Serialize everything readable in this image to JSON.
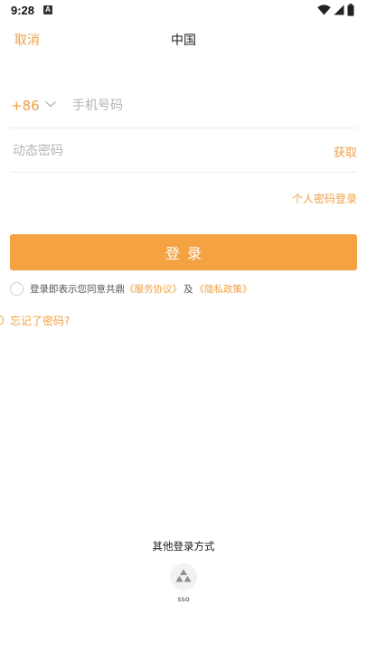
{
  "status_bar": {
    "time": "9:28",
    "notification_letter": "A"
  },
  "header": {
    "cancel_label": "取消",
    "title": "中国"
  },
  "phone": {
    "country_code": "+86",
    "placeholder": "手机号码"
  },
  "code": {
    "placeholder": "动态密码",
    "get_label": "获取"
  },
  "password_login_label": "个人密码登录",
  "login_button_label": "登录",
  "agreement": {
    "prefix": "登录即表示您同意共鼎",
    "service_link": "《服务协议》",
    "and": "及",
    "privacy_link": "《隐私政策》"
  },
  "forgot_password_label": "忘记了密码?",
  "other_login": {
    "title": "其他登录方式",
    "sso_label": "sso"
  },
  "colors": {
    "accent": "#f0a043",
    "button": "#f5a243",
    "divider": "#ececec",
    "placeholder": "#b3b3b3"
  },
  "icons": {
    "wifi": "wifi-icon",
    "signal": "signal-icon",
    "battery": "battery-icon",
    "chevron": "chevron-down-icon",
    "sso": "sso-triangle-icon"
  }
}
